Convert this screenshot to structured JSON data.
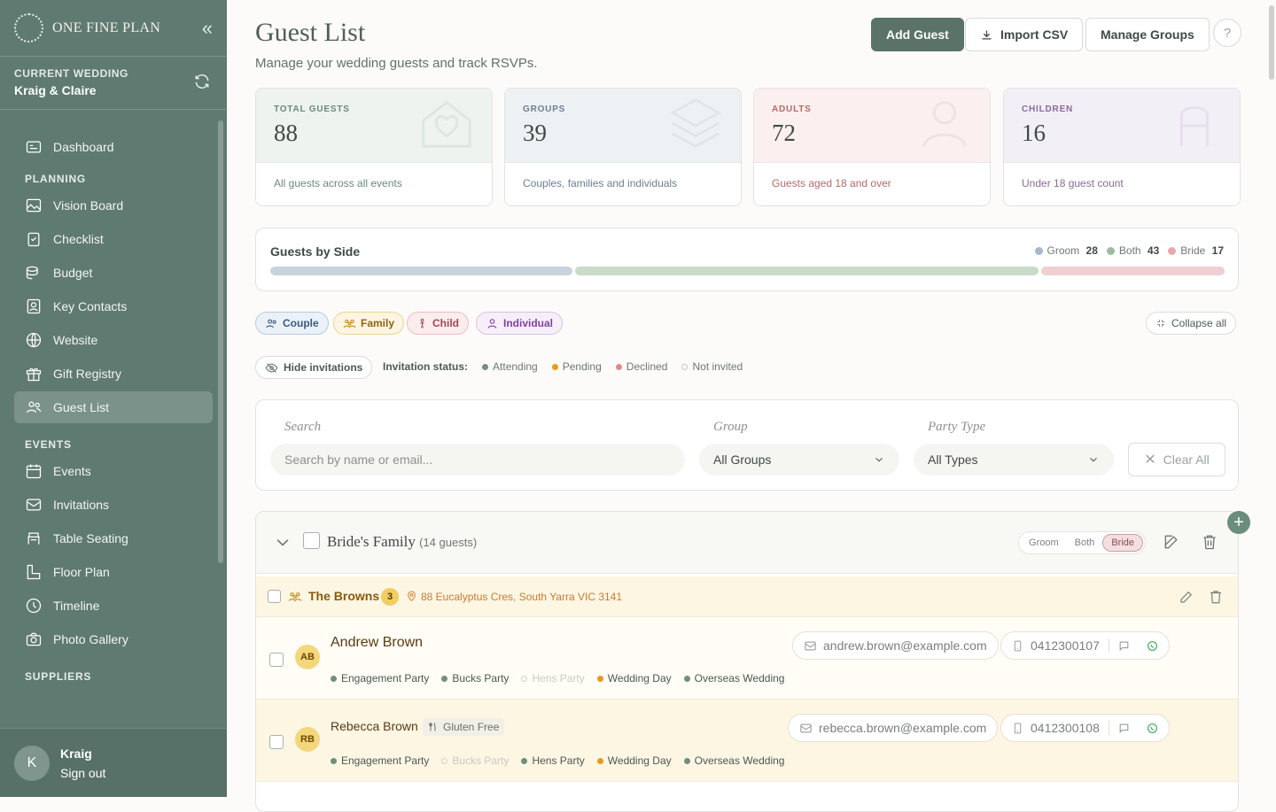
{
  "brand": {
    "name": "ONE FINE PLAN"
  },
  "current_wedding": {
    "label": "CURRENT WEDDING",
    "value": "Kraig & Claire"
  },
  "nav": {
    "dashboard": "Dashboard",
    "planning_label": "PLANNING",
    "planning": [
      "Vision Board",
      "Checklist",
      "Budget",
      "Key Contacts",
      "Website",
      "Gift Registry",
      "Guest List"
    ],
    "events_label": "EVENTS",
    "events": [
      "Events",
      "Invitations",
      "Table Seating",
      "Floor Plan",
      "Timeline",
      "Photo Gallery"
    ],
    "suppliers_label": "SUPPLIERS"
  },
  "user": {
    "initial": "K",
    "name": "Kraig",
    "signout": "Sign out"
  },
  "header": {
    "title": "Guest List",
    "subtitle": "Manage your wedding guests and track RSVPs.",
    "add_guest": "Add Guest",
    "import_csv": "Import CSV",
    "manage_groups": "Manage Groups",
    "help": "?"
  },
  "stats": [
    {
      "label": "TOTAL GUESTS",
      "value": "88",
      "desc": "All guests across all events",
      "icon": "house-heart-icon",
      "color": "#6a8a7d",
      "bg": "#eef3ef"
    },
    {
      "label": "GROUPS",
      "value": "39",
      "desc": "Couples, families and individuals",
      "icon": "layers-icon",
      "color": "#6b7f93",
      "bg": "#eef1f4"
    },
    {
      "label": "ADULTS",
      "value": "72",
      "desc": "Guests aged 18 and over",
      "icon": "person-icon",
      "color": "#b56a67",
      "bg": "#fbf0ef"
    },
    {
      "label": "CHILDREN",
      "value": "16",
      "desc": "Under 18 guest count",
      "icon": "child-icon",
      "color": "#8a6a9b",
      "bg": "#f3eff6"
    }
  ],
  "sides": {
    "title": "Guests by Side",
    "groom_label": "Groom",
    "groom": 28,
    "both_label": "Both",
    "both": 43,
    "bride_label": "Bride",
    "bride": 17,
    "colors": {
      "groom": "#c9d3dc",
      "both": "#c8dcc9",
      "bride": "#efcfd1"
    }
  },
  "types": {
    "couple": "Couple",
    "family": "Family",
    "child": "Child",
    "individual": "Individual",
    "collapse_all": "Collapse all"
  },
  "invitations": {
    "hide": "Hide invitations",
    "status_label": "Invitation status:",
    "attending": "Attending",
    "pending": "Pending",
    "declined": "Declined",
    "not_invited": "Not invited"
  },
  "filters": {
    "search_label": "Search",
    "search_placeholder": "Search by name or email...",
    "group_label": "Group",
    "group_value": "All Groups",
    "party_label": "Party Type",
    "party_value": "All Types",
    "clear": "Clear All"
  },
  "group": {
    "name": "Bride's Family",
    "count": "(14 guests)",
    "seg": [
      "Groom",
      "Both",
      "Bride"
    ],
    "party": {
      "name": "The Browns",
      "count": "3",
      "address": "88 Eucalyptus Cres, South Yarra VIC 3141"
    },
    "guests": [
      {
        "initials": "AB",
        "name": "Andrew Brown",
        "email": "andrew.brown@example.com",
        "phone": "0412300107",
        "tag": "",
        "events": [
          {
            "n": "Engagement Party",
            "s": "attending"
          },
          {
            "n": "Bucks Party",
            "s": "attending"
          },
          {
            "n": "Hens Party",
            "s": "off"
          },
          {
            "n": "Wedding Day",
            "s": "pending"
          },
          {
            "n": "Overseas Wedding",
            "s": "attending"
          }
        ]
      },
      {
        "initials": "RB",
        "name": "Rebecca Brown",
        "email": "rebecca.brown@example.com",
        "phone": "0412300108",
        "tag": "Gluten Free",
        "events": [
          {
            "n": "Engagement Party",
            "s": "attending"
          },
          {
            "n": "Bucks Party",
            "s": "off"
          },
          {
            "n": "Hens Party",
            "s": "attending"
          },
          {
            "n": "Wedding Day",
            "s": "pending"
          },
          {
            "n": "Overseas Wedding",
            "s": "attending"
          }
        ]
      }
    ]
  }
}
